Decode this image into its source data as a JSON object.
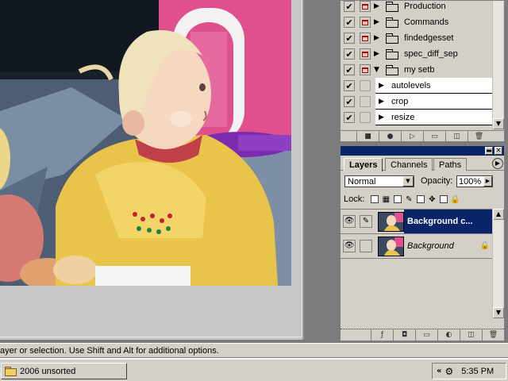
{
  "actions": {
    "items": [
      {
        "label": "Production",
        "type": "set",
        "expanded": false
      },
      {
        "label": "Commands",
        "type": "set",
        "expanded": false
      },
      {
        "label": "findedgesset",
        "type": "set",
        "expanded": false
      },
      {
        "label": "spec_diff_sep",
        "type": "set",
        "expanded": false
      },
      {
        "label": "my setb",
        "type": "set",
        "expanded": true
      },
      {
        "label": "autolevels",
        "type": "action"
      },
      {
        "label": "crop",
        "type": "action"
      },
      {
        "label": "resize",
        "type": "action"
      }
    ],
    "check_glyph": "✔",
    "toolbar_icons": [
      "stop-icon",
      "record-icon",
      "play-icon",
      "new-set-icon",
      "new-action-icon",
      "trash-icon"
    ]
  },
  "layers": {
    "tabs": [
      {
        "label": "Layers",
        "active": true
      },
      {
        "label": "Channels",
        "active": false
      },
      {
        "label": "Paths",
        "active": false
      }
    ],
    "blend_mode": "Normal",
    "opacity_label": "Opacity:",
    "opacity_value": "100%",
    "lock_label": "Lock:",
    "rows": [
      {
        "name": "Background c...",
        "selected": true
      },
      {
        "name": "Background",
        "selected": false,
        "locked": true
      }
    ],
    "toolbar_icons": [
      "layer-style-icon",
      "mask-icon",
      "new-group-icon",
      "adjustment-icon",
      "new-layer-icon",
      "trash-icon"
    ]
  },
  "status": {
    "text": "ayer or selection.  Use Shift and Alt for additional options."
  },
  "taskbar": {
    "task_label": "2006 unsorted",
    "chevron": "«",
    "clock": "5:35 PM"
  },
  "colors": {
    "selection": "#0a246a",
    "panel": "#d4d0c8",
    "workspace": "#7b7b7b"
  }
}
